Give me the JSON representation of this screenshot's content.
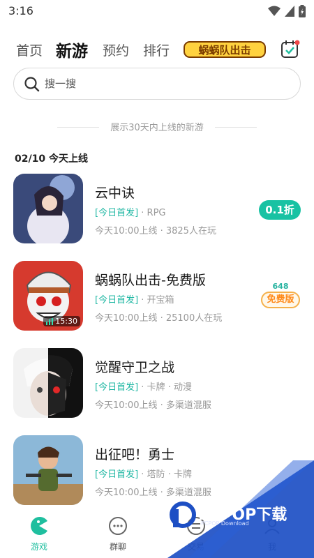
{
  "status_bar": {
    "time": "3:16"
  },
  "header": {
    "tabs": [
      {
        "label": "首页",
        "active": false
      },
      {
        "label": "新游",
        "active": true
      },
      {
        "label": "预约",
        "active": false
      },
      {
        "label": "排行",
        "active": false
      }
    ],
    "promo_logo_text": "蜗蜗队出击"
  },
  "search": {
    "placeholder": "搜一搜"
  },
  "notice": {
    "text": "展示30天内上线的新游"
  },
  "section": {
    "title": "02/10 今天上线"
  },
  "games": [
    {
      "name": "云中诀",
      "badge": "[今日首发]",
      "tags": "· RPG",
      "sub": "今天10:00上线 · 3825人在玩",
      "action": "0.1折"
    },
    {
      "name": "蜗蜗队出击-免费版",
      "badge": "[今日首发]",
      "tags": "· 开宝箱",
      "sub": "今天10:00上线 · 25100人在玩",
      "free_num": "648",
      "free_label": "免费版",
      "duration": "15:30"
    },
    {
      "name": "觉醒守卫之战",
      "badge": "[今日首发]",
      "tags": "· 卡牌 · 动漫",
      "sub": "今天10:00上线 · 多渠道混服"
    },
    {
      "name": "出征吧！勇士",
      "badge": "[今日首发]",
      "tags": "· 塔防 · 卡牌",
      "sub": "今天10:00上线 · 多渠道混服"
    }
  ],
  "bottom_nav": [
    {
      "label": "游戏",
      "icon": "pacman-icon",
      "active": true
    },
    {
      "label": "群聊",
      "icon": "chat-icon",
      "active": false
    },
    {
      "label": "交易",
      "icon": "trade-icon",
      "active": false
    },
    {
      "label": "我",
      "icon": "user-icon",
      "active": false
    }
  ],
  "watermark": {
    "text": "PCPOP下载",
    "sub": "PCPOP Download"
  },
  "colors": {
    "accent": "#1fbf9f",
    "discount": "#18c2a3",
    "free_border": "#f5b04a",
    "watermark_blue": "#1d4fc4"
  }
}
